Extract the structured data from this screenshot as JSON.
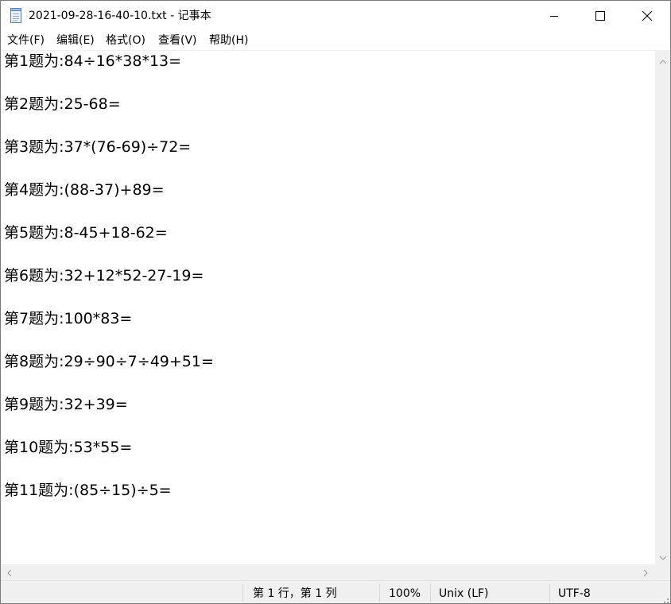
{
  "window": {
    "title": "2021-09-28-16-40-10.txt - 记事本"
  },
  "menu": {
    "items": [
      {
        "label": "文件(F)"
      },
      {
        "label": "编辑(E)"
      },
      {
        "label": "格式(O)"
      },
      {
        "label": "查看(V)"
      },
      {
        "label": "帮助(H)"
      }
    ]
  },
  "editor": {
    "lines": [
      "第1题为:84÷16*38*13=",
      "第2题为:25-68=",
      "第3题为:37*(76-69)÷72=",
      "第4题为:(88-37)+89=",
      "第5题为:8-45+18-62=",
      "第6题为:32+12*52-27-19=",
      "第7题为:100*83=",
      "第8题为:29÷90÷7÷49+51=",
      "第9题为:32+39=",
      "第10题为:53*55=",
      "第11题为:(85÷15)÷5="
    ]
  },
  "status": {
    "position": "第 1 行，第 1 列",
    "zoom": "100%",
    "line_ending": "Unix (LF)",
    "encoding": "UTF-8"
  },
  "icons": {
    "app": "notepad-icon",
    "minimize": "minimize-icon",
    "maximize": "maximize-icon",
    "close": "close-icon"
  }
}
